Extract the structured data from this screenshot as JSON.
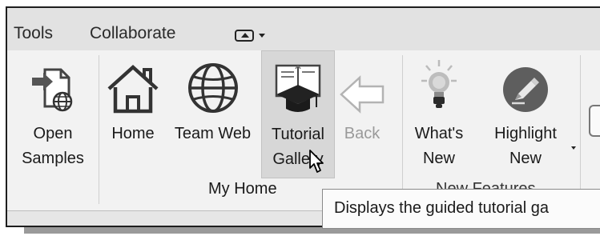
{
  "menubar": {
    "items": [
      "Tools",
      "Collaborate"
    ]
  },
  "ribbon": {
    "tools": [
      {
        "label": "Open\nSamples",
        "icon": "open-samples-icon",
        "enabled": true
      },
      {
        "label": "Home",
        "icon": "home-icon",
        "enabled": true
      },
      {
        "label": "Team Web",
        "icon": "globe-icon",
        "enabled": true
      },
      {
        "label": "Tutorial\nGallery",
        "icon": "tutorial-gallery-icon",
        "enabled": true,
        "hovered": true
      },
      {
        "label": "Back",
        "icon": "back-arrow-icon",
        "enabled": false
      },
      {
        "label": "What's\nNew",
        "icon": "lightbulb-icon",
        "enabled": true
      },
      {
        "label": "Highlight\nNew",
        "icon": "highlight-icon",
        "enabled": true,
        "has_dropdown": true
      }
    ],
    "panels": {
      "my_home": "My Home",
      "new_features": "New Features"
    }
  },
  "tooltip": {
    "text": "Displays the guided tutorial ga"
  },
  "colors": {
    "menubar_bg": "#e2e2e2",
    "ribbon_bg": "#f2f2f2",
    "hover_bg": "#d7d7d7"
  }
}
